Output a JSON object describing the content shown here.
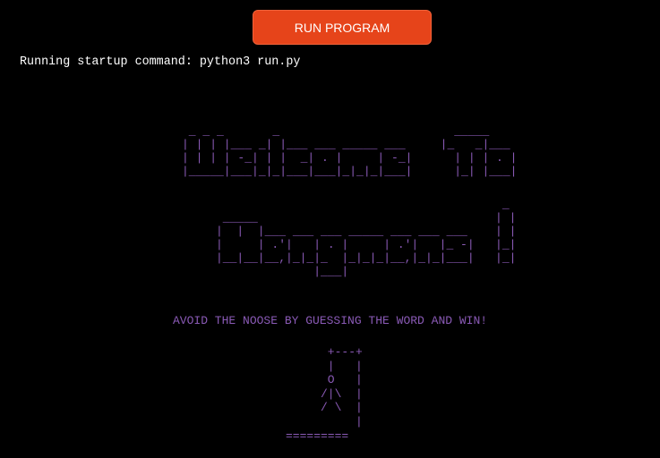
{
  "toolbar": {
    "run_label": "RUN PROGRAM",
    "accent_color": "#e6441a"
  },
  "terminal": {
    "startup_line": "Running startup command: python3 run.py",
    "banner_color": "#8a5ab6",
    "banner_welcome": " _ _ _       _                         _____        \n| | | |___ _| |___ ___ _____ ___     |_   _|___    \n| | | | -_| | |  _| . |     | -_|      | | | . |   \n|_____|___|_|_|___|___|_|_|_|___|      |_| |___|   ",
    "banner_hangman": "                                         _ \n _____                                  | |\n|  |  |___ ___ ___ _____ ___ ___ ___    | |\n|     | .'|   | . |     | .'|   |_ -|   |_|\n|__|__|__,|_|_|_  |_|_|_|__,|_|_|___|   |_|\n              |___|                         ",
    "tagline": "AVOID THE NOOSE BY GUESSING THE WORD AND WIN!",
    "gallows": "      +---+\n      |   |\n      O   |\n     /|\\  |\n     / \\  |\n          |\n========="
  }
}
